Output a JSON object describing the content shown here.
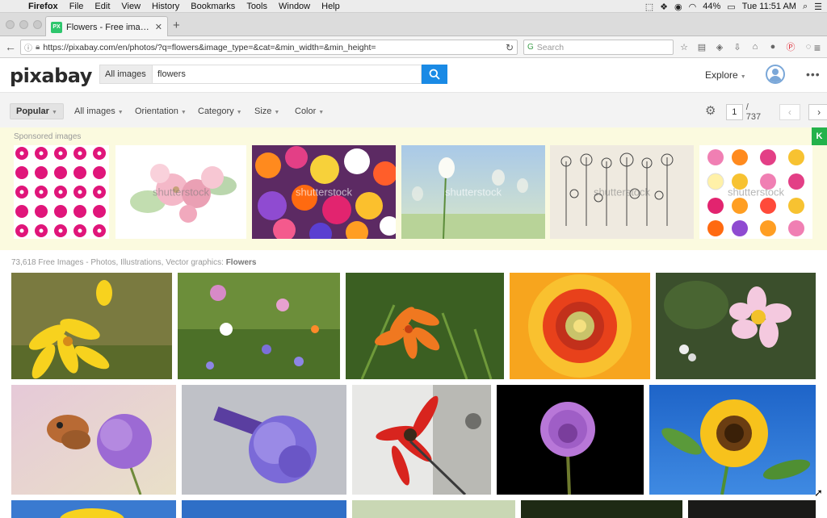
{
  "menubar": {
    "app": "Firefox",
    "items": [
      "File",
      "Edit",
      "View",
      "History",
      "Bookmarks",
      "Tools",
      "Window",
      "Help"
    ],
    "battery": "44%",
    "clock": "Tue 11:51 AM"
  },
  "tab": {
    "favicon": "PX",
    "title": "Flowers - Free images on P..."
  },
  "navbar": {
    "url": "https://pixabay.com/en/photos/?q=flowers&image_type=&cat=&min_width=&min_height=",
    "search_placeholder": "Search"
  },
  "site": {
    "logo": "pixabay",
    "type_select": "All images",
    "query": "flowers",
    "explore": "Explore"
  },
  "filters": {
    "popular": "Popular",
    "all_images": "All images",
    "orientation": "Orientation",
    "category": "Category",
    "size": "Size",
    "color": "Color",
    "page": "1",
    "page_total": "/ 737"
  },
  "sponsored": {
    "label": "Sponsored images",
    "watermark": "shutterstock",
    "badge": "K"
  },
  "results": {
    "count": "73,618 Free Images - Photos, Illustrations, Vector graphics:",
    "term": "Flowers"
  },
  "colors": {
    "accent": "#1a8ae5",
    "sponsored_bg": "#fbfadf",
    "filter_bg": "#f3f3f3"
  }
}
